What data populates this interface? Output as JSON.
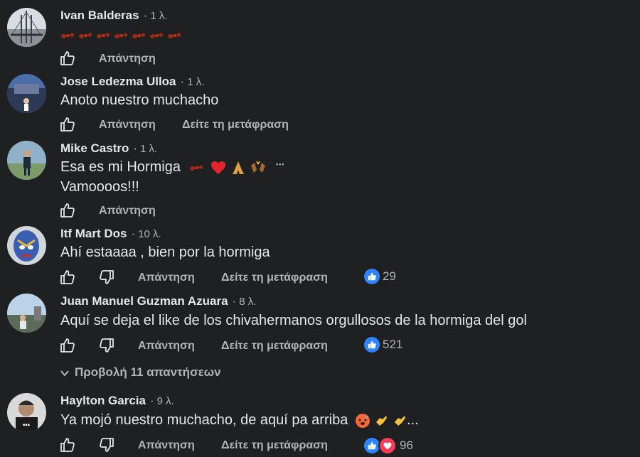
{
  "labels": {
    "reply": "Απάντηση",
    "see_translation": "Δείτε τη μετάφραση"
  },
  "comments": [
    {
      "name": "Ivan Balderas",
      "time": "1 λ.",
      "text": ""
    },
    {
      "name": "Jose Ledezma Ulloa",
      "time": "1 λ.",
      "text": "Anoto nuestro muchacho"
    },
    {
      "name": "Mike Castro",
      "time": "1 λ.",
      "text": "Esa es mi Hormiga",
      "text2": "Vamoooos!!!"
    },
    {
      "name": "Itf Mart Dos",
      "time": "10 λ.",
      "text": "Ahí estaaaa , bien por la hormiga",
      "reactions": "29"
    },
    {
      "name": "Juan Manuel Guzman Azuara",
      "time": "8 λ.",
      "text": "Aquí se deja el like de los chivahermanos orgullosos de la hormiga del gol",
      "reactions": "521"
    },
    {
      "name": "Haylton Garcia",
      "time": "9 λ.",
      "text": "Ya mojó nuestro muchacho, de aquí pa arriba",
      "text_suffix": "...",
      "reactions": "96"
    }
  ],
  "view_replies": "Προβολή 11 απαντήσεων",
  "more_dots": "•••",
  "name_separator": "·",
  "icons": [
    "like-icon",
    "dislike-icon",
    "ant-emoji",
    "heart-emoji",
    "praying-hands-emoji",
    "raising-hands-emoji",
    "hot-face-emoji",
    "call-me-hand-emoji",
    "chevron-down-icon"
  ],
  "colors": {
    "background": "#1f2022",
    "text": "#e4e6eb",
    "muted": "#b0b3b8",
    "like_blue": "#2d86ff",
    "heart_red": "#f33e58"
  }
}
